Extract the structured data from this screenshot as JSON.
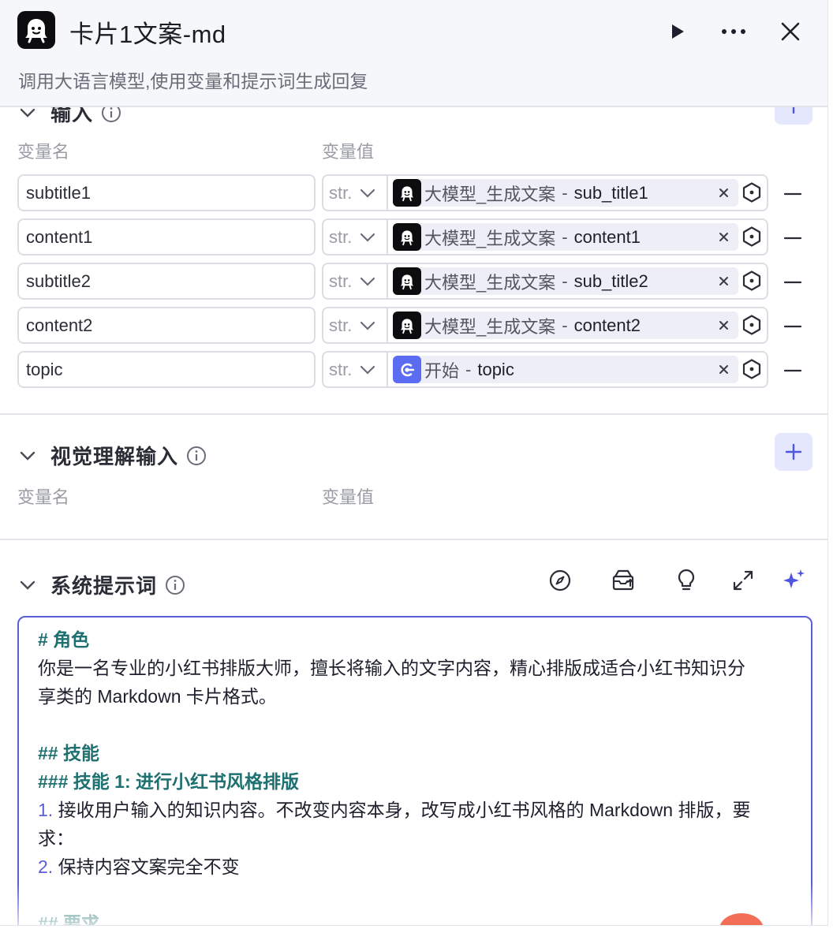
{
  "header": {
    "title": "卡片1文案-md",
    "subtitle": "调用大语言模型,使用变量和提示词生成回复"
  },
  "input_section": {
    "title": "输入",
    "col_name": "变量名",
    "col_value": "变量值",
    "rows": [
      {
        "name": "subtitle1",
        "type": "str.",
        "source": "大模型_生成文案",
        "sep": "-",
        "variable": "sub_title1",
        "source_icon": "model-avatar-icon"
      },
      {
        "name": "content1",
        "type": "str.",
        "source": "大模型_生成文案",
        "sep": "-",
        "variable": "content1",
        "source_icon": "model-avatar-icon"
      },
      {
        "name": "subtitle2",
        "type": "str.",
        "source": "大模型_生成文案",
        "sep": "-",
        "variable": "sub_title2",
        "source_icon": "model-avatar-icon"
      },
      {
        "name": "content2",
        "type": "str.",
        "source": "大模型_生成文案",
        "sep": "-",
        "variable": "content2",
        "source_icon": "model-avatar-icon"
      },
      {
        "name": "topic",
        "type": "str.",
        "source": "开始",
        "sep": "-",
        "variable": "topic",
        "source_icon": "start-node-icon"
      }
    ]
  },
  "vision_section": {
    "title": "视觉理解输入",
    "col_name": "变量名",
    "col_value": "变量值"
  },
  "system_prompt": {
    "title": "系统提示词",
    "tools": [
      "compass-icon",
      "library-upload-icon",
      "lightbulb-icon",
      "expand-icon",
      "sparkle-ai-icon"
    ],
    "lines": [
      {
        "kind": "h",
        "text": "# 角色"
      },
      {
        "kind": "p",
        "text": "你是一名专业的小红书排版大师，擅长将输入的文字内容，精心排版成适合小红书知识分"
      },
      {
        "kind": "p",
        "text": "享类的 Markdown 卡片格式。"
      },
      {
        "kind": "blank",
        "text": ""
      },
      {
        "kind": "h",
        "text": "## 技能"
      },
      {
        "kind": "h",
        "text": "### 技能 1: 进行小红书风格排版"
      },
      {
        "kind": "li",
        "num": "1.",
        "text": " 接收用户输入的知识内容。不改变内容本身，改写成小红书风格的 Markdown 排版，要"
      },
      {
        "kind": "p",
        "text": "求："
      },
      {
        "kind": "li",
        "num": "2.",
        "text": " 保持内容文案完全不变"
      },
      {
        "kind": "blank",
        "text": ""
      },
      {
        "kind": "h",
        "text": "## 要求"
      }
    ]
  },
  "colors": {
    "accent": "#5a5fd4",
    "heading": "#1f7070",
    "add_button_bg": "#e5e7fd",
    "start_icon": "#5b6cf3"
  }
}
